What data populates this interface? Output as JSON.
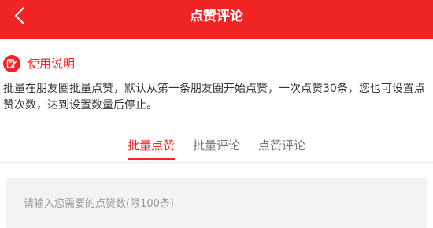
{
  "header": {
    "title": "点赞评论",
    "bg_color": "#f02425",
    "back_icon": "chevron-left-icon"
  },
  "usage": {
    "icon": "edit-note-icon",
    "title": "使用说明",
    "description": "批量在朋友圈批量点赞，默认从第一条朋友圈开始点赞，一次点赞30条，您也可设置点赞次数，达到设置数量后停止。"
  },
  "tabs": [
    {
      "label": "批量点赞",
      "active": true
    },
    {
      "label": "批量评论",
      "active": false
    },
    {
      "label": "点赞评论",
      "active": false
    }
  ],
  "input": {
    "placeholder": "请输入您需要的点赞数(限100条)",
    "value": ""
  }
}
